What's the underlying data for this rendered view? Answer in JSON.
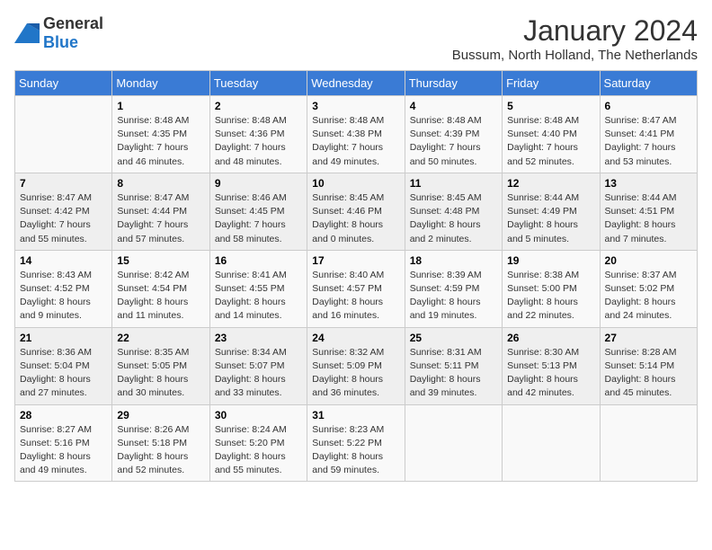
{
  "header": {
    "logo_general": "General",
    "logo_blue": "Blue",
    "title": "January 2024",
    "location": "Bussum, North Holland, The Netherlands"
  },
  "days_of_week": [
    "Sunday",
    "Monday",
    "Tuesday",
    "Wednesday",
    "Thursday",
    "Friday",
    "Saturday"
  ],
  "weeks": [
    [
      {
        "num": "",
        "sunrise": "",
        "sunset": "",
        "daylight": ""
      },
      {
        "num": "1",
        "sunrise": "Sunrise: 8:48 AM",
        "sunset": "Sunset: 4:35 PM",
        "daylight": "Daylight: 7 hours and 46 minutes."
      },
      {
        "num": "2",
        "sunrise": "Sunrise: 8:48 AM",
        "sunset": "Sunset: 4:36 PM",
        "daylight": "Daylight: 7 hours and 48 minutes."
      },
      {
        "num": "3",
        "sunrise": "Sunrise: 8:48 AM",
        "sunset": "Sunset: 4:38 PM",
        "daylight": "Daylight: 7 hours and 49 minutes."
      },
      {
        "num": "4",
        "sunrise": "Sunrise: 8:48 AM",
        "sunset": "Sunset: 4:39 PM",
        "daylight": "Daylight: 7 hours and 50 minutes."
      },
      {
        "num": "5",
        "sunrise": "Sunrise: 8:48 AM",
        "sunset": "Sunset: 4:40 PM",
        "daylight": "Daylight: 7 hours and 52 minutes."
      },
      {
        "num": "6",
        "sunrise": "Sunrise: 8:47 AM",
        "sunset": "Sunset: 4:41 PM",
        "daylight": "Daylight: 7 hours and 53 minutes."
      }
    ],
    [
      {
        "num": "7",
        "sunrise": "Sunrise: 8:47 AM",
        "sunset": "Sunset: 4:42 PM",
        "daylight": "Daylight: 7 hours and 55 minutes."
      },
      {
        "num": "8",
        "sunrise": "Sunrise: 8:47 AM",
        "sunset": "Sunset: 4:44 PM",
        "daylight": "Daylight: 7 hours and 57 minutes."
      },
      {
        "num": "9",
        "sunrise": "Sunrise: 8:46 AM",
        "sunset": "Sunset: 4:45 PM",
        "daylight": "Daylight: 7 hours and 58 minutes."
      },
      {
        "num": "10",
        "sunrise": "Sunrise: 8:45 AM",
        "sunset": "Sunset: 4:46 PM",
        "daylight": "Daylight: 8 hours and 0 minutes."
      },
      {
        "num": "11",
        "sunrise": "Sunrise: 8:45 AM",
        "sunset": "Sunset: 4:48 PM",
        "daylight": "Daylight: 8 hours and 2 minutes."
      },
      {
        "num": "12",
        "sunrise": "Sunrise: 8:44 AM",
        "sunset": "Sunset: 4:49 PM",
        "daylight": "Daylight: 8 hours and 5 minutes."
      },
      {
        "num": "13",
        "sunrise": "Sunrise: 8:44 AM",
        "sunset": "Sunset: 4:51 PM",
        "daylight": "Daylight: 8 hours and 7 minutes."
      }
    ],
    [
      {
        "num": "14",
        "sunrise": "Sunrise: 8:43 AM",
        "sunset": "Sunset: 4:52 PM",
        "daylight": "Daylight: 8 hours and 9 minutes."
      },
      {
        "num": "15",
        "sunrise": "Sunrise: 8:42 AM",
        "sunset": "Sunset: 4:54 PM",
        "daylight": "Daylight: 8 hours and 11 minutes."
      },
      {
        "num": "16",
        "sunrise": "Sunrise: 8:41 AM",
        "sunset": "Sunset: 4:55 PM",
        "daylight": "Daylight: 8 hours and 14 minutes."
      },
      {
        "num": "17",
        "sunrise": "Sunrise: 8:40 AM",
        "sunset": "Sunset: 4:57 PM",
        "daylight": "Daylight: 8 hours and 16 minutes."
      },
      {
        "num": "18",
        "sunrise": "Sunrise: 8:39 AM",
        "sunset": "Sunset: 4:59 PM",
        "daylight": "Daylight: 8 hours and 19 minutes."
      },
      {
        "num": "19",
        "sunrise": "Sunrise: 8:38 AM",
        "sunset": "Sunset: 5:00 PM",
        "daylight": "Daylight: 8 hours and 22 minutes."
      },
      {
        "num": "20",
        "sunrise": "Sunrise: 8:37 AM",
        "sunset": "Sunset: 5:02 PM",
        "daylight": "Daylight: 8 hours and 24 minutes."
      }
    ],
    [
      {
        "num": "21",
        "sunrise": "Sunrise: 8:36 AM",
        "sunset": "Sunset: 5:04 PM",
        "daylight": "Daylight: 8 hours and 27 minutes."
      },
      {
        "num": "22",
        "sunrise": "Sunrise: 8:35 AM",
        "sunset": "Sunset: 5:05 PM",
        "daylight": "Daylight: 8 hours and 30 minutes."
      },
      {
        "num": "23",
        "sunrise": "Sunrise: 8:34 AM",
        "sunset": "Sunset: 5:07 PM",
        "daylight": "Daylight: 8 hours and 33 minutes."
      },
      {
        "num": "24",
        "sunrise": "Sunrise: 8:32 AM",
        "sunset": "Sunset: 5:09 PM",
        "daylight": "Daylight: 8 hours and 36 minutes."
      },
      {
        "num": "25",
        "sunrise": "Sunrise: 8:31 AM",
        "sunset": "Sunset: 5:11 PM",
        "daylight": "Daylight: 8 hours and 39 minutes."
      },
      {
        "num": "26",
        "sunrise": "Sunrise: 8:30 AM",
        "sunset": "Sunset: 5:13 PM",
        "daylight": "Daylight: 8 hours and 42 minutes."
      },
      {
        "num": "27",
        "sunrise": "Sunrise: 8:28 AM",
        "sunset": "Sunset: 5:14 PM",
        "daylight": "Daylight: 8 hours and 45 minutes."
      }
    ],
    [
      {
        "num": "28",
        "sunrise": "Sunrise: 8:27 AM",
        "sunset": "Sunset: 5:16 PM",
        "daylight": "Daylight: 8 hours and 49 minutes."
      },
      {
        "num": "29",
        "sunrise": "Sunrise: 8:26 AM",
        "sunset": "Sunset: 5:18 PM",
        "daylight": "Daylight: 8 hours and 52 minutes."
      },
      {
        "num": "30",
        "sunrise": "Sunrise: 8:24 AM",
        "sunset": "Sunset: 5:20 PM",
        "daylight": "Daylight: 8 hours and 55 minutes."
      },
      {
        "num": "31",
        "sunrise": "Sunrise: 8:23 AM",
        "sunset": "Sunset: 5:22 PM",
        "daylight": "Daylight: 8 hours and 59 minutes."
      },
      {
        "num": "",
        "sunrise": "",
        "sunset": "",
        "daylight": ""
      },
      {
        "num": "",
        "sunrise": "",
        "sunset": "",
        "daylight": ""
      },
      {
        "num": "",
        "sunrise": "",
        "sunset": "",
        "daylight": ""
      }
    ]
  ]
}
